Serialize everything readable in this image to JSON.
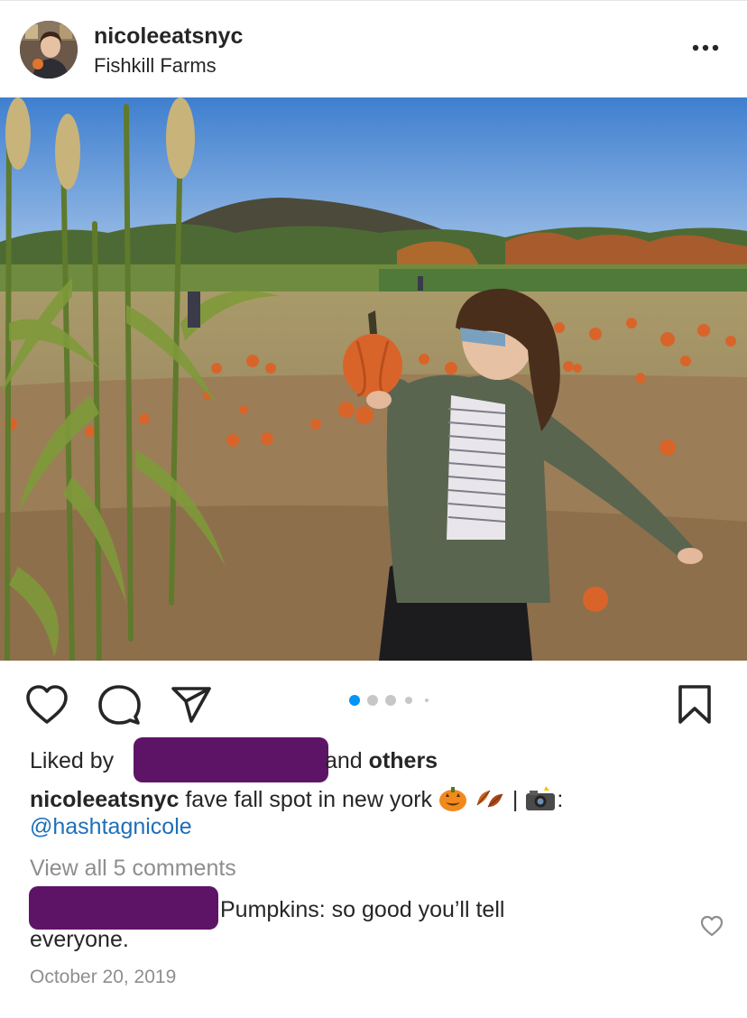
{
  "post": {
    "username": "nicoleeatsnyc",
    "location": "Fishkill Farms",
    "carousel": {
      "total": 5,
      "active": 1
    }
  },
  "likes": {
    "prefix": "Liked by",
    "suffix_and": "and",
    "suffix_others": "others"
  },
  "caption": {
    "username": "nicoleeatsnyc",
    "text": "fave fall spot in new york",
    "separator": "|",
    "colon": ":",
    "mention": "@hashtagnicole",
    "emoji_icons": [
      "jack-o-lantern-icon",
      "fallen-leaf-icon",
      "camera-flash-icon"
    ]
  },
  "comments": {
    "view_all": "View all 5 comments",
    "preview_text_line1": "Pumpkins: so good you’ll tell",
    "preview_text_line2": "everyone."
  },
  "timestamp": "October 20, 2019",
  "colors": {
    "text": "#262626",
    "muted": "#8e8e8e",
    "link": "#1e6fb8",
    "carousel_active": "#0095f6",
    "carousel_inactive": "#c7c7c7",
    "redaction": "#5e1466"
  }
}
